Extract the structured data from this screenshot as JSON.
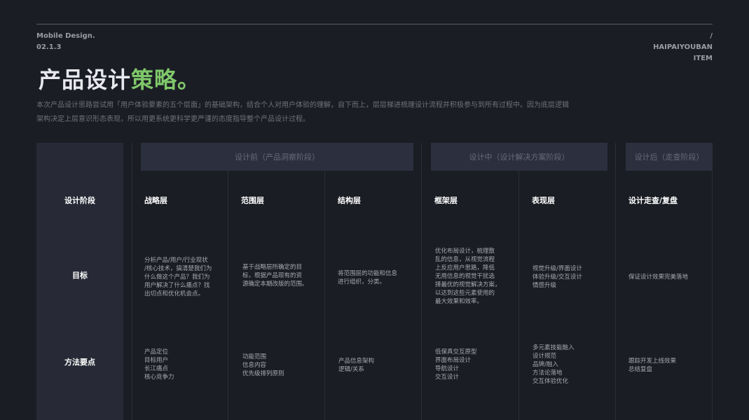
{
  "header": {
    "brand_line1": "Mobile Design.",
    "brand_line2": "02.1.3",
    "right_line1": "/",
    "right_line2": "HAIPAIYOUBAN",
    "right_line3": "ITEM"
  },
  "title": {
    "main": "产品设计",
    "accent": "策略。"
  },
  "description": "本次产品设计思路尝试用「用户体验要素的五个层面」的基础架构，结合个人对用户体验的理解，自下而上，层层梯进梳理设计流程并积极参与到所有过程中。因为底层逻辑架构决定上层意识形态表现，所以用更系统更科学更严谨的态度指导整个产品设计过程。",
  "colors": {
    "background": "#1b1d24",
    "accent": "#7fc86a",
    "panel": "#272a36",
    "phase_bg": "#2c2f3d"
  },
  "phases": [
    "设计前（产品洞察阶段）",
    "设计中（设计解决方案阶段）",
    "设计后（走查阶段）"
  ],
  "row_labels": {
    "stage": "设计阶段",
    "goal": "目标",
    "method": "方法要点"
  },
  "columns": [
    {
      "name": "战略层",
      "goal": "分析产品/用户/行业现状\n/核心技术，搞清楚我们为\n什么做这个产品？我们为\n用户解决了什么痛点？找\n出切点和优化机会点。",
      "method": "产品定位\n目标用户\n长江痛点\n核心竞争力"
    },
    {
      "name": "范围层",
      "goal": "基于战略层所确定的目\n标，根据产品现有的资\n源确定本期改版的范围。",
      "method": "功能范围\n信息内容\n优先级排列原则"
    },
    {
      "name": "结构层",
      "goal": "将范围层的功能和信息\n进行组织，分类。",
      "method": "产品信息架构\n逻辑/关系"
    },
    {
      "name": "框架层",
      "goal": "优化布局设计，梳理散\n乱的信息，从视觉流程\n上反应用户思路，降低\n无用信息的视觉干扰选\n择最优的视觉解决方案，\n以达到这些元素使用的\n最大效果和效率。",
      "method": "低保真交互原型\n界面布局设计\n导航设计\n交互设计"
    },
    {
      "name": "表现层",
      "goal": "视觉升级/界面设计\n体验升级/交互设计\n情感升级",
      "method": "多元素技能融入\n设计规范\n品牌/融入\n方法论落地\n交互体验优化"
    },
    {
      "name": "设计走查/复盘",
      "goal": "保证设计效果完美落地",
      "method": "跟踪开发上线效果\n总结复盘"
    }
  ]
}
